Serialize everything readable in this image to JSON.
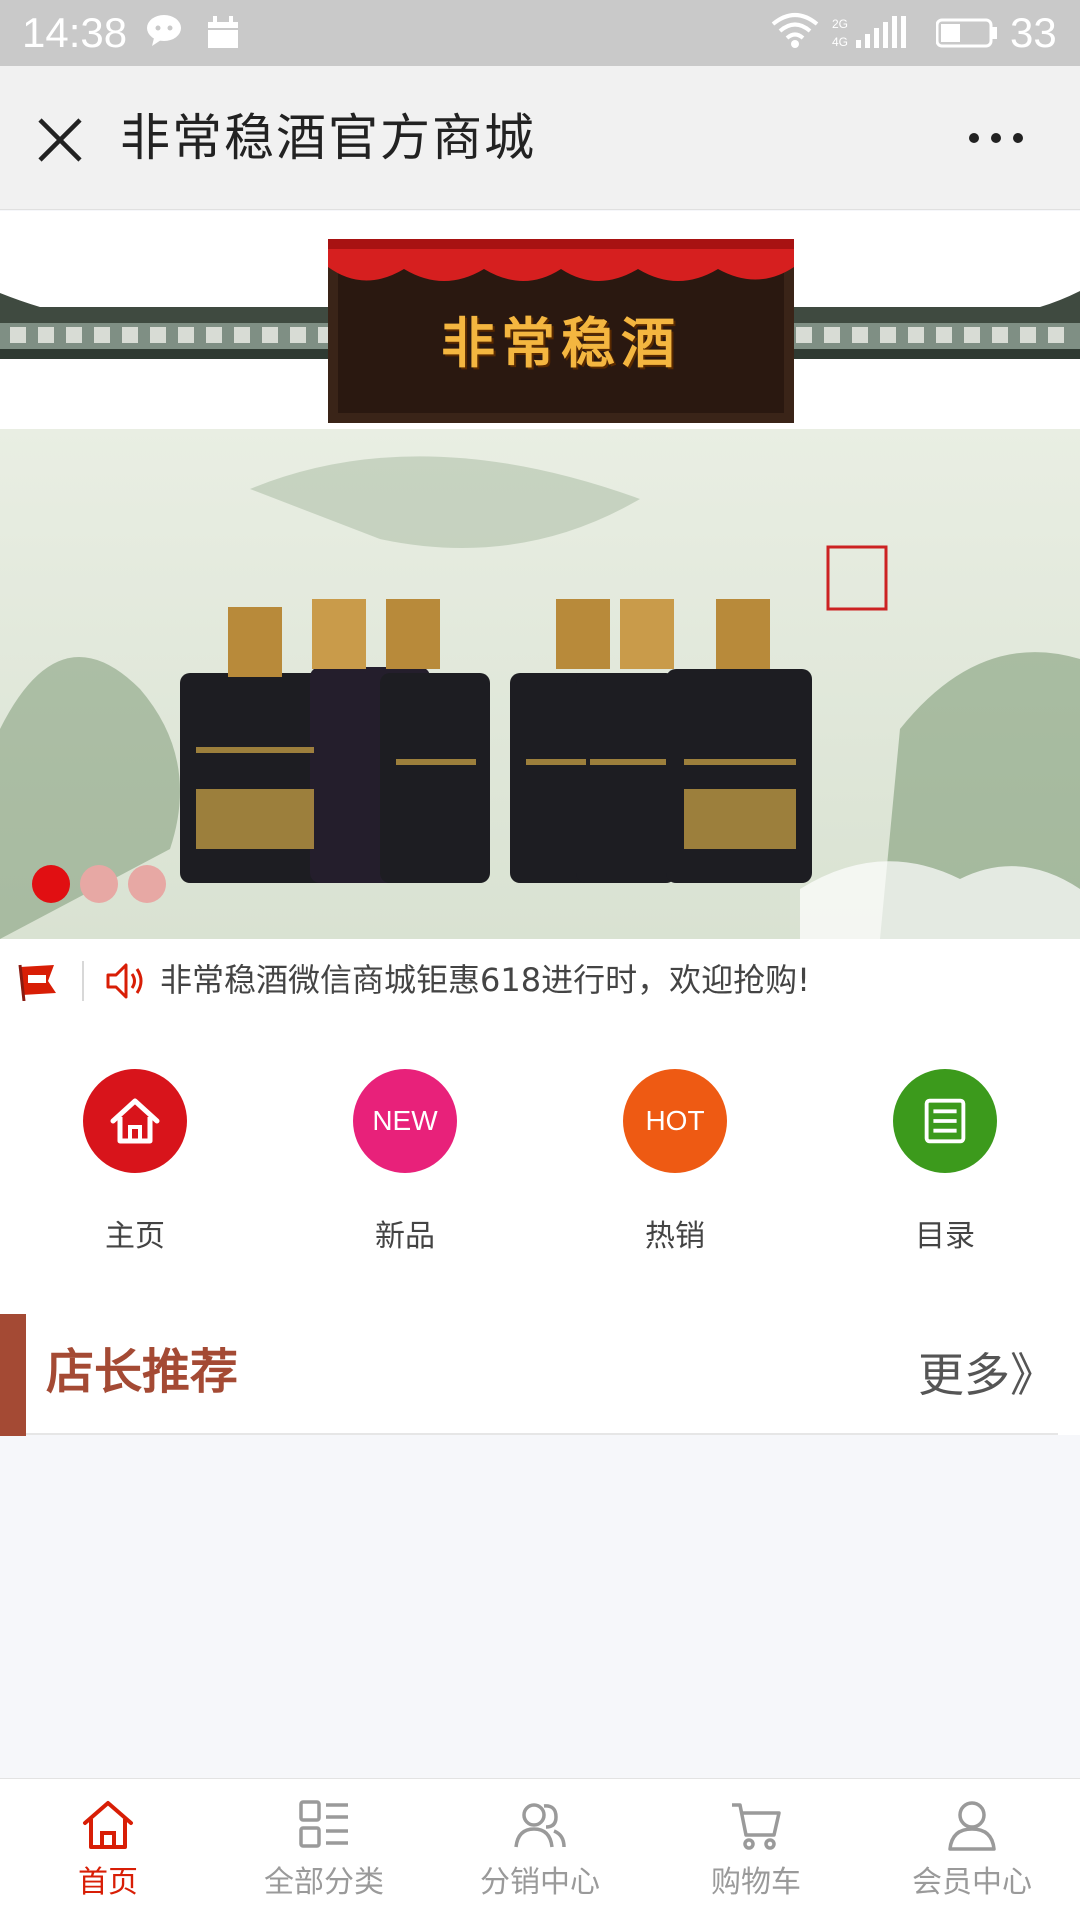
{
  "status_bar": {
    "time": "14:38",
    "battery_level": "33",
    "icons": [
      "wechat-icon",
      "calendar-icon",
      "wifi-icon",
      "signal-icon",
      "battery-icon"
    ]
  },
  "nav": {
    "title": "非常稳酒官方商城",
    "close_icon": "close-icon",
    "more_icon": "more-icon"
  },
  "header_banner": {
    "sign_text": "非常稳酒"
  },
  "carousel": {
    "slide_count": 3,
    "active_index": 0,
    "colors": {
      "active": "#e10f12",
      "inactive": "#e7a8a4"
    }
  },
  "notice": {
    "text": "非常稳酒微信商城钜惠618进行时，欢迎抢购!",
    "icons": [
      "flag-icon",
      "speaker-icon"
    ]
  },
  "quick_menu": [
    {
      "label": "主页",
      "icon": "home-icon",
      "color": "#d8141b"
    },
    {
      "label": "新品",
      "icon": "new-badge-icon",
      "badge": "NEW",
      "color": "#e8217a"
    },
    {
      "label": "热销",
      "icon": "hot-badge-icon",
      "badge": "HOT",
      "color": "#ee5a13"
    },
    {
      "label": "目录",
      "icon": "catalog-icon",
      "color": "#3c9a1c"
    }
  ],
  "section": {
    "title": "店长推荐",
    "more": "更多》",
    "accent_color": "#a44a34"
  },
  "tabs": [
    {
      "label": "首页",
      "icon": "home-icon",
      "active": true
    },
    {
      "label": "全部分类",
      "icon": "category-icon",
      "active": false
    },
    {
      "label": "分销中心",
      "icon": "users-icon",
      "active": false
    },
    {
      "label": "购物车",
      "icon": "cart-icon",
      "active": false
    },
    {
      "label": "会员中心",
      "icon": "user-icon",
      "active": false
    }
  ],
  "colors": {
    "tab_active": "#d81e06",
    "tab_inactive": "#9a9a9a"
  }
}
